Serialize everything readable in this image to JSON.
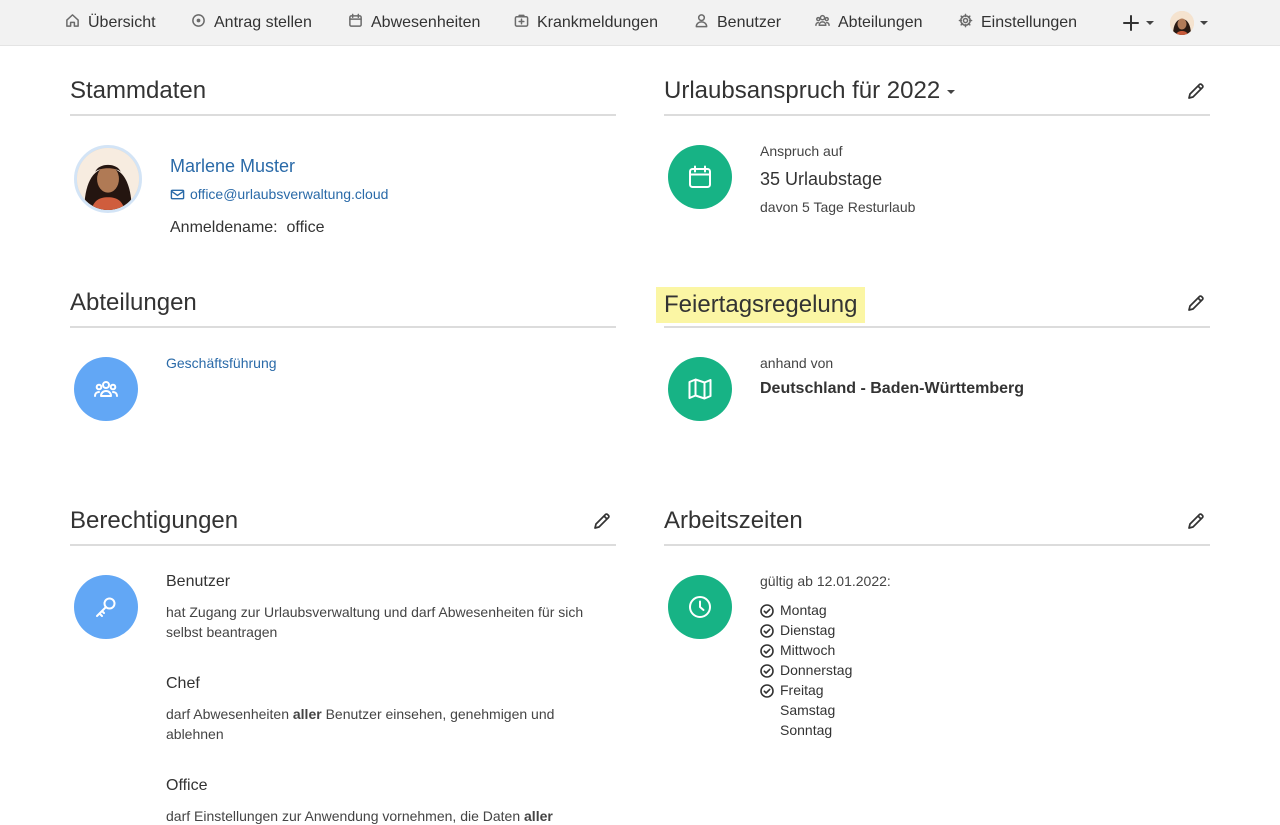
{
  "nav": {
    "items": [
      {
        "label": "Übersicht",
        "icon": "home-icon"
      },
      {
        "label": "Antrag stellen",
        "icon": "plus-circle-icon"
      },
      {
        "label": "Abwesenheiten",
        "icon": "calendar-icon"
      },
      {
        "label": "Krankmeldungen",
        "icon": "medkit-icon"
      },
      {
        "label": "Benutzer",
        "icon": "user-icon"
      },
      {
        "label": "Abteilungen",
        "icon": "users-icon"
      },
      {
        "label": "Einstellungen",
        "icon": "gear-icon"
      }
    ]
  },
  "stammdaten": {
    "title": "Stammdaten",
    "name": "Marlene Muster",
    "email": "office@urlaubsverwaltung.cloud",
    "login_label": "Anmeldename:",
    "login_value": "office"
  },
  "urlaubsanspruch": {
    "title": "Urlaubsanspruch für 2022",
    "label": "Anspruch auf",
    "days": "35 Urlaubstage",
    "remaining": "davon 5 Tage Resturlaub"
  },
  "abteilungen": {
    "title": "Abteilungen",
    "items": [
      "Geschäftsführung"
    ]
  },
  "feiertag": {
    "title": "Feiertagsregelung",
    "label": "anhand von",
    "value": "Deutschland - Baden-Württemberg"
  },
  "berechtigungen": {
    "title": "Berechtigungen",
    "roles": [
      {
        "name": "Benutzer",
        "desc_a": "hat Zugang zur Urlaubsverwaltung und darf Abwesenheiten für sich",
        "desc_b": "selbst beantragen"
      },
      {
        "name": "Chef",
        "desc_pre": "darf Abwesenheiten ",
        "desc_bold": "aller",
        "desc_post": " Benutzer einsehen, genehmigen und",
        "desc_b": "ablehnen"
      },
      {
        "name": "Office",
        "desc_pre": "darf Einstellungen zur Anwendung vornehmen, die Daten ",
        "desc_bold": "aller"
      }
    ]
  },
  "arbeitszeiten": {
    "title": "Arbeitszeiten",
    "valid_from": "gültig ab 12.01.2022:",
    "days": [
      {
        "name": "Montag",
        "active": true
      },
      {
        "name": "Dienstag",
        "active": true
      },
      {
        "name": "Mittwoch",
        "active": true
      },
      {
        "name": "Donnerstag",
        "active": true
      },
      {
        "name": "Freitag",
        "active": true
      },
      {
        "name": "Samstag",
        "active": false
      },
      {
        "name": "Sonntag",
        "active": false
      }
    ]
  },
  "colors": {
    "accent_green": "#17b385",
    "accent_blue": "#62a7f5",
    "link": "#2a6aa8",
    "highlight": "#fbf6a4"
  }
}
